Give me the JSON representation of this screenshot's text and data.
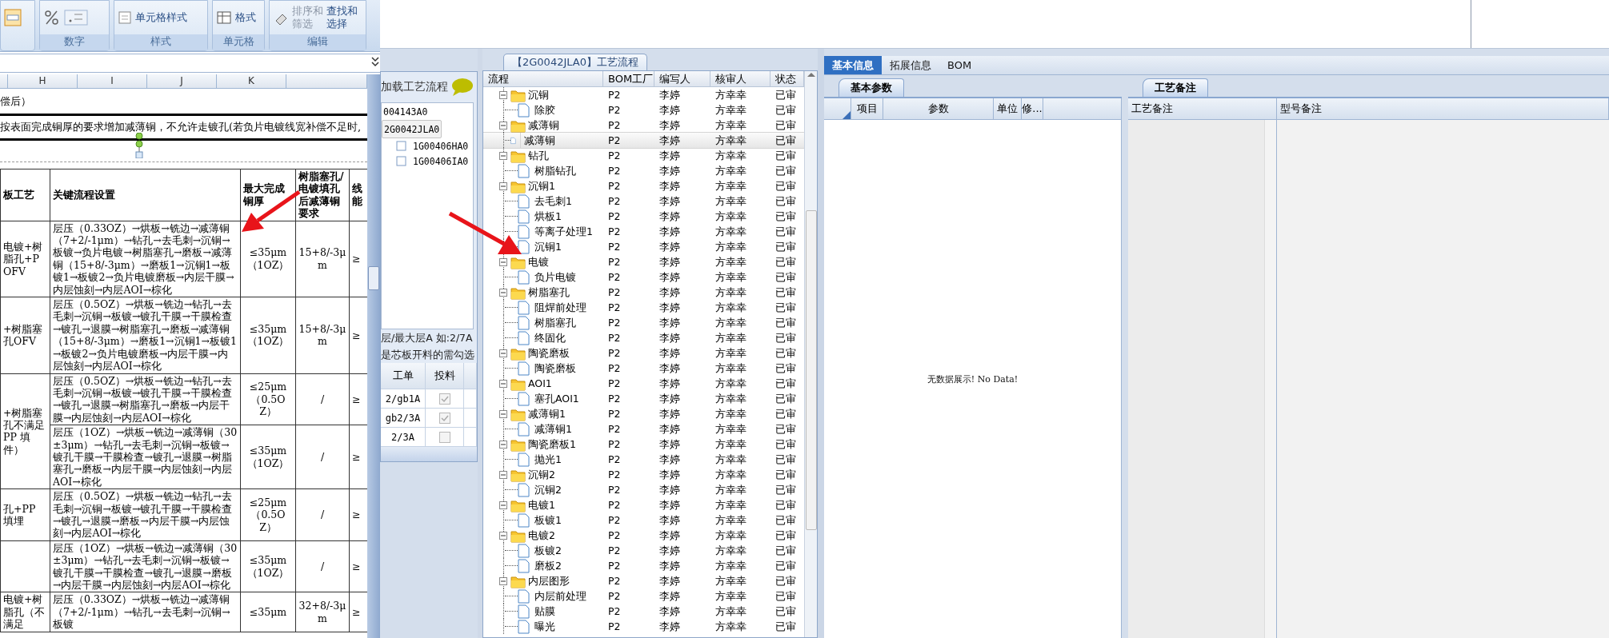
{
  "ribbon": {
    "groups": [
      {
        "kind": "number",
        "label": "数字"
      },
      {
        "kind": "styles",
        "label": "样式",
        "items": [
          [
            "单元格样式"
          ]
        ]
      },
      {
        "kind": "cells",
        "label": "单元格",
        "items": [
          [
            "格式"
          ]
        ]
      },
      {
        "kind": "editing",
        "label": "编辑",
        "items": [
          [
            "排序和",
            "筛选"
          ],
          [
            "查找和",
            "选择"
          ]
        ]
      }
    ]
  },
  "sheet": {
    "columns": [
      "H",
      "I",
      "J",
      "K"
    ],
    "note_1": "偿后）",
    "note_2": "按表面完成铜厚的要求增加减薄铜，不允许走镀孔(若负片电镀线宽补偿不足时,",
    "headers": [
      "板工艺",
      "关键流程设置",
      "最大完成铜厚",
      "树脂塞孔/电镀填孔后减薄铜要求",
      "线能"
    ],
    "groups": [
      {
        "process": "电镀+树脂孔+POFV",
        "rows": [
          {
            "flow": "层压（0.33OZ）→烘板→铣边→减薄铜（7+2/-1μm）→钻孔→去毛刺→沉铜→板镀→负片电镀→树脂塞孔→磨板→减薄铜（15+8/-3μm）→磨板1→沉铜1→板镀1→板镀2→负片电镀磨板→内层干膜→内层蚀刻→内层AOI→棕化",
            "max_copper": "≤35μm\n（1OZ）",
            "resin": "15+8/-3μm",
            "extra": "≥"
          }
        ]
      },
      {
        "process": "+树脂塞孔OFV",
        "rows": [
          {
            "flow": "层压（0.5OZ）→烘板→铣边→钻孔→去毛刺→沉铜→板镀→镀孔干膜→干膜检查→镀孔→退膜→树脂塞孔→磨板→减薄铜（15+8/-3μm）→磨板1→沉铜1→板镀1→板镀2→负片电镀磨板→内层干膜→内层蚀刻→内层AOI→棕化",
            "max_copper": "≤35μm\n（1OZ）",
            "resin": "15+8/-3μm",
            "extra": "≥"
          }
        ]
      },
      {
        "process": "+树脂塞孔不满足 PP 填件）",
        "rows": [
          {
            "flow": "层压（0.5OZ）→烘板→铣边→钻孔→去毛刺→沉铜→板镀→镀孔干膜→干膜检查→镀孔→退膜→树脂塞孔→磨板→内层干膜→内层蚀刻→内层AOI→棕化",
            "max_copper": "≤25μm\n（0.5OZ）",
            "resin": "/",
            "extra": "≥"
          },
          {
            "flow": "层压（1OZ）→烘板→铣边→减薄铜（30±3μm）→钻孔→去毛刺→沉铜→板镀→镀孔干膜→干膜检查→镀孔→退膜→树脂塞孔→磨板→内层干膜→内层蚀刻→内层AOI→棕化",
            "max_copper": "≤35μm\n（1OZ）",
            "resin": "/",
            "extra": "≥"
          }
        ]
      },
      {
        "process": "孔+PP 填埋",
        "rows": [
          {
            "flow": "层压（0.5OZ）→烘板→铣边→钻孔→去毛刺→沉铜→板镀→镀孔干膜→干膜检查→镀孔→退膜→磨板→内层干膜→内层蚀刻→内层AOI→棕化",
            "max_copper": "≤25μm\n（0.5OZ）",
            "resin": "/",
            "extra": "≥"
          }
        ]
      },
      {
        "rows": [
          {
            "flow": "层压（1OZ）→烘板→铣边→减薄铜（30±3μm）→钻孔→去毛刺→沉铜→板镀→镀孔干膜→干膜检查→镀孔→退膜→磨板→内层干膜→内层蚀刻→内层AOI→棕化",
            "max_copper": "≤35μm\n（1OZ）",
            "resin": "/",
            "extra": "≥"
          }
        ]
      },
      {
        "process": "电镀+树脂孔（不满足",
        "rows": [
          {
            "flow": "层压（0.33OZ）→烘板→铣边→减薄铜（7+2/-1μm）→钻孔→去毛刺→沉铜→板镀",
            "max_copper": "≤35μm",
            "resin": "32+8/-3μm",
            "extra": "≥"
          }
        ]
      }
    ]
  },
  "loader": {
    "title": "加载工艺流程",
    "items": [
      {
        "label": "004143A0",
        "selected": false
      },
      {
        "label": "2G0042JLA0",
        "selected": true,
        "children": [
          {
            "label": "1G00406HA0",
            "selected": false
          },
          {
            "label": "1G00406IA0",
            "selected": false
          }
        ]
      }
    ],
    "hint_1": "层/最大层A 如:2/7A",
    "hint_2": "是芯板开料的需勾选",
    "columns": [
      "工单",
      "投料"
    ],
    "rows": [
      {
        "order": "2/gb1A",
        "fed": true
      },
      {
        "order": "gb2/3A",
        "fed": true
      },
      {
        "order": "2/3A",
        "fed": false
      }
    ]
  },
  "flow": {
    "title": "【2G0042JLA0】工艺流程",
    "columns": [
      "流程",
      "BOM工厂",
      "编写人",
      "核审人",
      "状态"
    ],
    "nodes": [
      {
        "name": "沉铜",
        "expanded": true,
        "factory": "P2",
        "author": "李婷",
        "reviewer": "方幸幸",
        "status": "已审",
        "children": [
          {
            "name": "除胶",
            "selected": false,
            "factory": "P2",
            "author": "李婷",
            "reviewer": "方幸幸",
            "status": "已审"
          }
        ]
      },
      {
        "name": "减薄铜",
        "expanded": true,
        "factory": "P2",
        "author": "李婷",
        "reviewer": "方幸幸",
        "status": "已审",
        "children": [
          {
            "name": "减薄铜",
            "selected": true,
            "factory": "P2",
            "author": "李婷",
            "reviewer": "方幸幸",
            "status": "已审"
          }
        ]
      },
      {
        "name": "钻孔",
        "expanded": true,
        "factory": "P2",
        "author": "李婷",
        "reviewer": "方幸幸",
        "status": "已审",
        "children": [
          {
            "name": "树脂钻孔",
            "selected": false,
            "factory": "P2",
            "author": "李婷",
            "reviewer": "方幸幸",
            "status": "已审"
          }
        ]
      },
      {
        "name": "沉铜1",
        "expanded": true,
        "factory": "P2",
        "author": "李婷",
        "reviewer": "方幸幸",
        "status": "已审",
        "children": [
          {
            "name": "去毛刺1",
            "selected": false,
            "factory": "P2",
            "author": "李婷",
            "reviewer": "方幸幸",
            "status": "已审"
          },
          {
            "name": "烘板1",
            "selected": false,
            "factory": "P2",
            "author": "李婷",
            "reviewer": "方幸幸",
            "status": "已审"
          },
          {
            "name": "等离子处理1",
            "selected": false,
            "factory": "P2",
            "author": "李婷",
            "reviewer": "方幸幸",
            "status": "已审"
          },
          {
            "name": "沉铜1",
            "selected": false,
            "factory": "P2",
            "author": "李婷",
            "reviewer": "方幸幸",
            "status": "已审"
          }
        ]
      },
      {
        "name": "电镀",
        "expanded": true,
        "factory": "P2",
        "author": "李婷",
        "reviewer": "方幸幸",
        "status": "已审",
        "children": [
          {
            "name": "负片电镀",
            "selected": false,
            "factory": "P2",
            "author": "李婷",
            "reviewer": "方幸幸",
            "status": "已审"
          }
        ]
      },
      {
        "name": "树脂塞孔",
        "expanded": true,
        "factory": "P2",
        "author": "李婷",
        "reviewer": "方幸幸",
        "status": "已审",
        "children": [
          {
            "name": "阻焊前处理",
            "selected": false,
            "factory": "P2",
            "author": "李婷",
            "reviewer": "方幸幸",
            "status": "已审"
          },
          {
            "name": "树脂塞孔",
            "selected": false,
            "factory": "P2",
            "author": "李婷",
            "reviewer": "方幸幸",
            "status": "已审"
          },
          {
            "name": "终固化",
            "selected": false,
            "factory": "P2",
            "author": "李婷",
            "reviewer": "方幸幸",
            "status": "已审"
          }
        ]
      },
      {
        "name": "陶瓷磨板",
        "expanded": true,
        "factory": "P2",
        "author": "李婷",
        "reviewer": "方幸幸",
        "status": "已审",
        "children": [
          {
            "name": "陶瓷磨板",
            "selected": false,
            "factory": "P2",
            "author": "李婷",
            "reviewer": "方幸幸",
            "status": "已审"
          }
        ]
      },
      {
        "name": "AOI1",
        "expanded": true,
        "factory": "P2",
        "author": "李婷",
        "reviewer": "方幸幸",
        "status": "已审",
        "children": [
          {
            "name": "塞孔AOI1",
            "selected": false,
            "factory": "P2",
            "author": "李婷",
            "reviewer": "方幸幸",
            "status": "已审"
          }
        ]
      },
      {
        "name": "减薄铜1",
        "expanded": true,
        "factory": "P2",
        "author": "李婷",
        "reviewer": "方幸幸",
        "status": "已审",
        "children": [
          {
            "name": "减薄铜1",
            "selected": false,
            "factory": "P2",
            "author": "李婷",
            "reviewer": "方幸幸",
            "status": "已审"
          }
        ]
      },
      {
        "name": "陶瓷磨板1",
        "expanded": true,
        "factory": "P2",
        "author": "李婷",
        "reviewer": "方幸幸",
        "status": "已审",
        "children": [
          {
            "name": "抛光1",
            "selected": false,
            "factory": "P2",
            "author": "李婷",
            "reviewer": "方幸幸",
            "status": "已审"
          }
        ]
      },
      {
        "name": "沉铜2",
        "expanded": true,
        "factory": "P2",
        "author": "李婷",
        "reviewer": "方幸幸",
        "status": "已审",
        "children": [
          {
            "name": "沉铜2",
            "selected": false,
            "factory": "P2",
            "author": "李婷",
            "reviewer": "方幸幸",
            "status": "已审"
          }
        ]
      },
      {
        "name": "电镀1",
        "expanded": true,
        "factory": "P2",
        "author": "李婷",
        "reviewer": "方幸幸",
        "status": "已审",
        "children": [
          {
            "name": "板镀1",
            "selected": false,
            "factory": "P2",
            "author": "李婷",
            "reviewer": "方幸幸",
            "status": "已审"
          }
        ]
      },
      {
        "name": "电镀2",
        "expanded": true,
        "factory": "P2",
        "author": "李婷",
        "reviewer": "方幸幸",
        "status": "已审",
        "children": [
          {
            "name": "板镀2",
            "selected": false,
            "factory": "P2",
            "author": "李婷",
            "reviewer": "方幸幸",
            "status": "已审"
          },
          {
            "name": "磨板2",
            "selected": false,
            "factory": "P2",
            "author": "李婷",
            "reviewer": "方幸幸",
            "status": "已审"
          }
        ]
      },
      {
        "name": "内层图形",
        "expanded": true,
        "factory": "P2",
        "author": "李婷",
        "reviewer": "方幸幸",
        "status": "已审",
        "children": [
          {
            "name": "内层前处理",
            "selected": false,
            "factory": "P2",
            "author": "李婷",
            "reviewer": "方幸幸",
            "status": "已审"
          },
          {
            "name": "贴膜",
            "selected": false,
            "factory": "P2",
            "author": "李婷",
            "reviewer": "方幸幸",
            "status": "已审"
          },
          {
            "name": "曝光",
            "selected": false,
            "factory": "P2",
            "author": "李婷",
            "reviewer": "方幸幸",
            "status": "已审"
          }
        ]
      }
    ]
  },
  "info": {
    "tabs": [
      {
        "label": "基本信息",
        "selected": true
      },
      {
        "label": "拓展信息",
        "selected": false
      },
      {
        "label": "BOM",
        "selected": false
      }
    ],
    "params": {
      "tab": "基本参数",
      "columns": [
        "项目",
        "参数",
        "单位",
        "修..."
      ],
      "empty_text": "无数据展示! No Data!"
    },
    "notes": {
      "tab": "工艺备注",
      "columns": [
        "工艺备注",
        "型号备注"
      ]
    }
  }
}
